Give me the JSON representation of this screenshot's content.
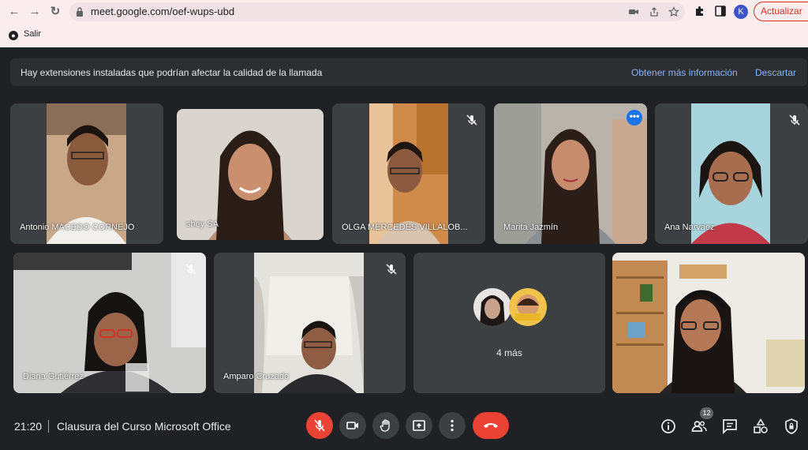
{
  "browser": {
    "url": "meet.google.com/oef-wups-ubd",
    "update_label": "Actualizar",
    "profile_initial": "K",
    "bookmark": {
      "label": "Salir"
    }
  },
  "banner": {
    "message": "Hay extensiones instaladas que podrían afectar la calidad de la llamada",
    "learn_more": "Obtener más información",
    "dismiss": "Descartar"
  },
  "participants": [
    {
      "name": "Antonio MACEDO CORNEJO",
      "muted": false
    },
    {
      "name": "shey SA",
      "muted": false
    },
    {
      "name": "OLGA MERCEDES VILLALOB...",
      "muted": true
    },
    {
      "name": "Marita Jazmín",
      "muted": false,
      "active_speaker": true
    },
    {
      "name": "Ana Narvaez",
      "muted": true
    },
    {
      "name": "Diana Gutiérrez",
      "muted": true
    },
    {
      "name": "Amparo Cruzado",
      "muted": true
    },
    {
      "name": "",
      "muted": false
    }
  ],
  "more_tile": {
    "label": "4 más"
  },
  "bottom_bar": {
    "time": "21:20",
    "meeting_title": "Clausura del Curso Microsoft Office",
    "participants_count": "12"
  },
  "colors": {
    "background": "#202124",
    "tile": "#3c4043",
    "accent": "#8ab4f8",
    "danger": "#ea4335",
    "chrome": "#fbecee"
  }
}
